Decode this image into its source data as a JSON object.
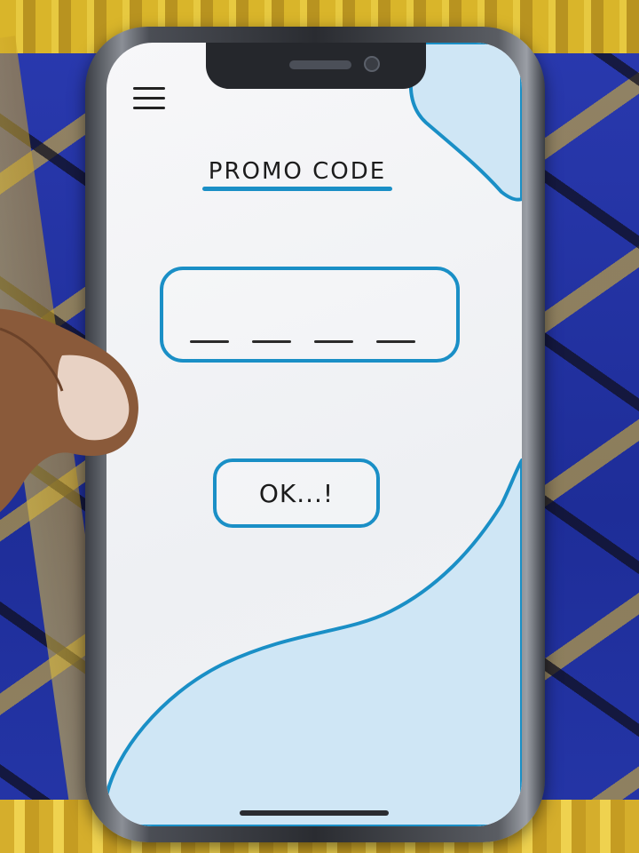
{
  "screen": {
    "title": "PROMO CODE",
    "promo_input": {
      "value": "",
      "slot_count": 4
    },
    "ok_button_label": "OK...!",
    "menu_icon": "hamburger-menu-icon"
  },
  "colors": {
    "accent_blue": "#1a8fc6",
    "watercolor_fill": "#cfe6f5",
    "ink": "#1c1c1c"
  }
}
